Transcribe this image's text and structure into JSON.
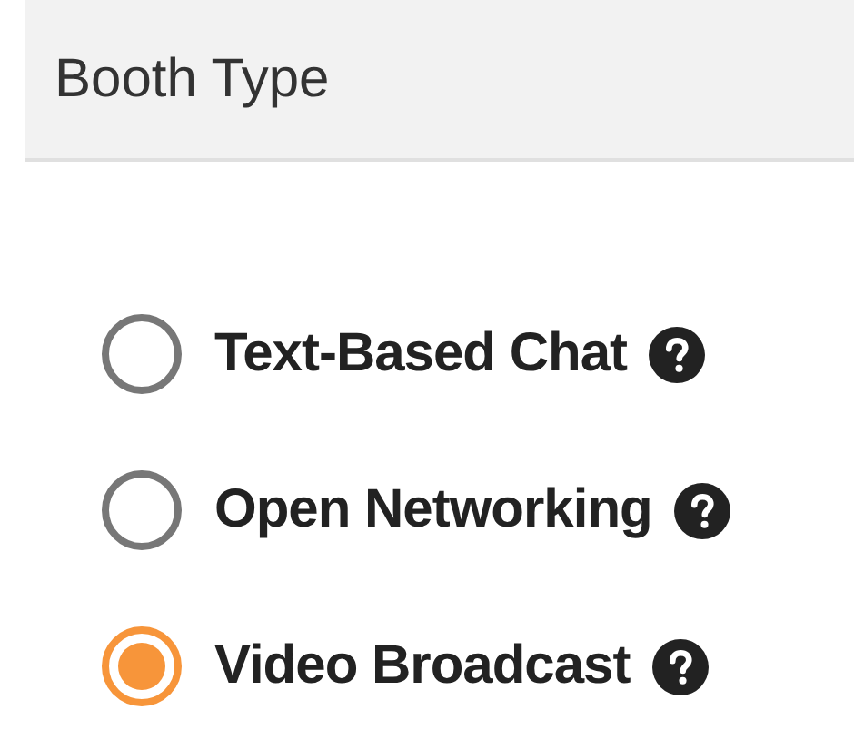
{
  "panel": {
    "title": "Booth Type"
  },
  "options": [
    {
      "label": "Text-Based Chat",
      "selected": false
    },
    {
      "label": "Open Networking",
      "selected": false
    },
    {
      "label": "Video Broadcast",
      "selected": true
    }
  ]
}
